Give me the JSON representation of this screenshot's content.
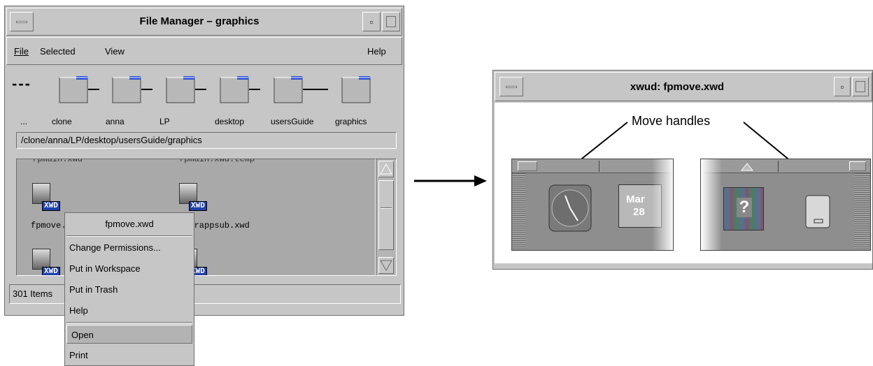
{
  "file_manager": {
    "title": "File Manager – graphics",
    "menu": {
      "file": "File",
      "selected": "Selected",
      "view": "View",
      "help": "Help"
    },
    "path_dashes": "---",
    "breadcrumb": [
      "...",
      "clone",
      "anna",
      "LP",
      "desktop",
      "usersGuide",
      "graphics"
    ],
    "path_field": "/clone/anna/LP/desktop/usersGuide/graphics",
    "files": {
      "top_left": "fpmain.xwd",
      "top_right": "fpmain.xwd.temp",
      "icon_badge": "XWD",
      "file1": "fpmove.xwd",
      "file2": "peerappsub.xwd"
    },
    "status": "301 Items"
  },
  "context_menu": {
    "title": "fpmove.xwd",
    "items": [
      "Change Permissions...",
      "Put in Workspace",
      "Put in Trash",
      "Help",
      "Open",
      "Print"
    ]
  },
  "xwud": {
    "title": "xwud: fpmove.xwd",
    "annotation": "Move handles",
    "calendar_month": "Mar",
    "calendar_day": "28",
    "help_glyph": "?"
  },
  "colors": {
    "window_gray": "#c6c6c6",
    "selection_blue": "#1f3faa",
    "folder_tab": "#2a4fd6"
  }
}
